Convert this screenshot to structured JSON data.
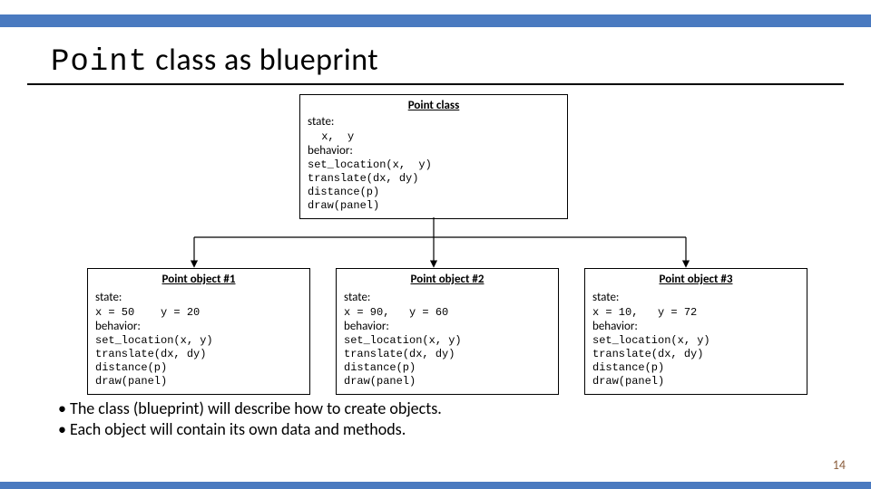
{
  "slide": {
    "title_code": "Point",
    "title_rest": " class as blueprint",
    "page_number": "14"
  },
  "class_box": {
    "title": "Point class",
    "state_label": "state:",
    "state_vars": " x,  y",
    "behavior_label": "behavior:",
    "behaviors": "set_location(x,  y)\ntranslate(dx, dy)\ndistance(p)\ndraw(panel)"
  },
  "objects": [
    {
      "title": "Point object #1",
      "state_label": "state:",
      "state_vals": "x = 50    y = 20",
      "behavior_label": "behavior:",
      "behaviors": "set_location(x, y)\ntranslate(dx, dy)\ndistance(p)\ndraw(panel)"
    },
    {
      "title": "Point object #2",
      "state_label": "state:",
      "state_vals": "x = 90,   y = 60",
      "behavior_label": "behavior:",
      "behaviors": "set_location(x, y)\ntranslate(dx, dy)\ndistance(p)\ndraw(panel)"
    },
    {
      "title": "Point object #3",
      "state_label": "state:",
      "state_vals": "x = 10,   y = 72",
      "behavior_label": "behavior:",
      "behaviors": "set_location(x, y)\ntranslate(dx, dy)\ndistance(p)\ndraw(panel)"
    }
  ],
  "bullets": {
    "b1": "The class (blueprint) will describe how to create objects.",
    "b2": "Each object will contain its own data and methods."
  }
}
